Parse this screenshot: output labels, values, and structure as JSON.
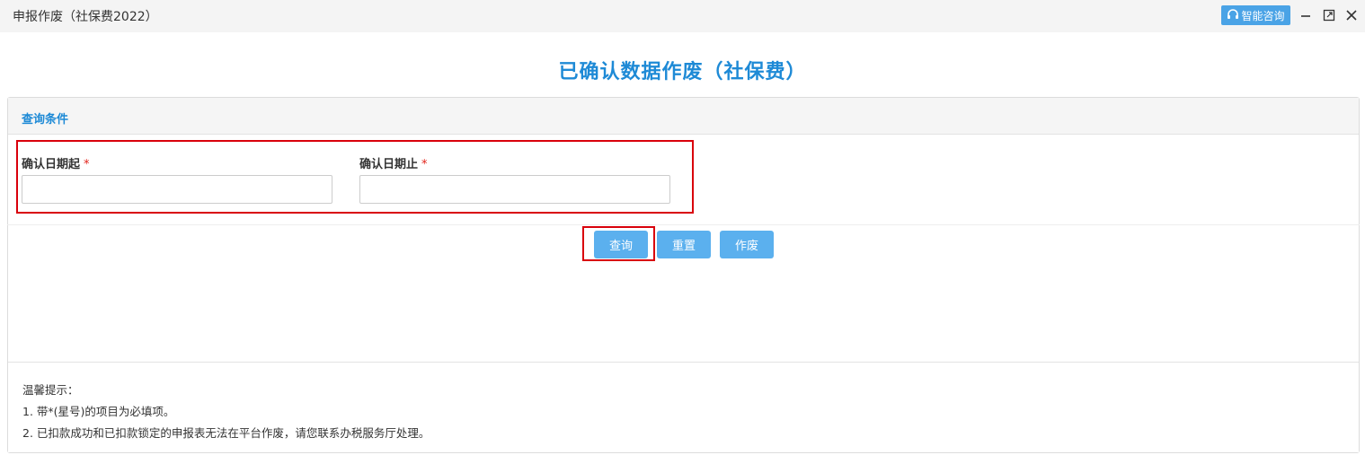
{
  "window": {
    "title": "申报作废（社保费2022）",
    "help_label": "智能咨询",
    "accent": "#4aa3e6"
  },
  "page": {
    "heading": "已确认数据作废（社保费）",
    "heading_color": "#1e8ad6"
  },
  "query_panel": {
    "title": "查询条件",
    "fields": [
      {
        "label": "确认日期起",
        "required_mark": "*",
        "value": "",
        "placeholder": ""
      },
      {
        "label": "确认日期止",
        "required_mark": "*",
        "value": "",
        "placeholder": ""
      }
    ]
  },
  "buttons": {
    "query": "查询",
    "reset": "重置",
    "void": "作废"
  },
  "tips": {
    "title": "温馨提示：",
    "items": [
      "1. 带*(星号)的项目为必填项。",
      "2. 已扣款成功和已扣款锁定的申报表无法在平台作废，请您联系办税服务厅处理。"
    ]
  },
  "highlight_color": "#d9000b"
}
